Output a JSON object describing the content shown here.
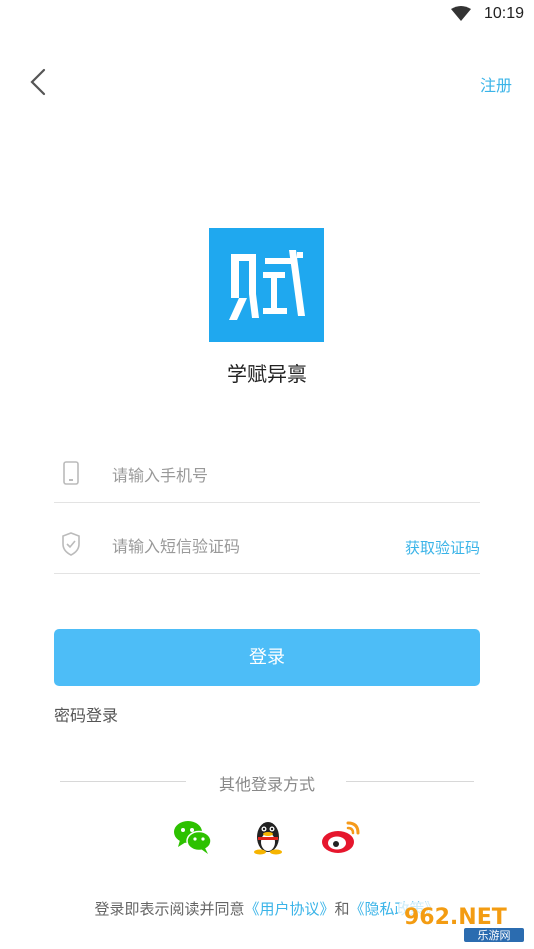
{
  "status_bar": {
    "time": "10:19"
  },
  "header": {
    "register_label": "注册"
  },
  "app": {
    "name": "学赋异禀",
    "logo_text": "赋"
  },
  "form": {
    "phone_placeholder": "请输入手机号",
    "code_placeholder": "请输入短信验证码",
    "get_code_label": "获取验证码",
    "login_label": "登录",
    "password_login_label": "密码登录"
  },
  "other_login": {
    "label": "其他登录方式",
    "methods": [
      "wechat",
      "qq",
      "weibo"
    ]
  },
  "agreement": {
    "prefix": "登录即表示阅读并同意",
    "user_agreement": "《用户协议》",
    "conjunction": "和",
    "privacy_policy": "《隐私政策》"
  },
  "watermark": {
    "text": "962.NET",
    "subtext": "乐游网"
  },
  "colors": {
    "accent": "#3bb4e8",
    "button": "#4dbdf7",
    "logo_bg": "#1fa8ef"
  }
}
